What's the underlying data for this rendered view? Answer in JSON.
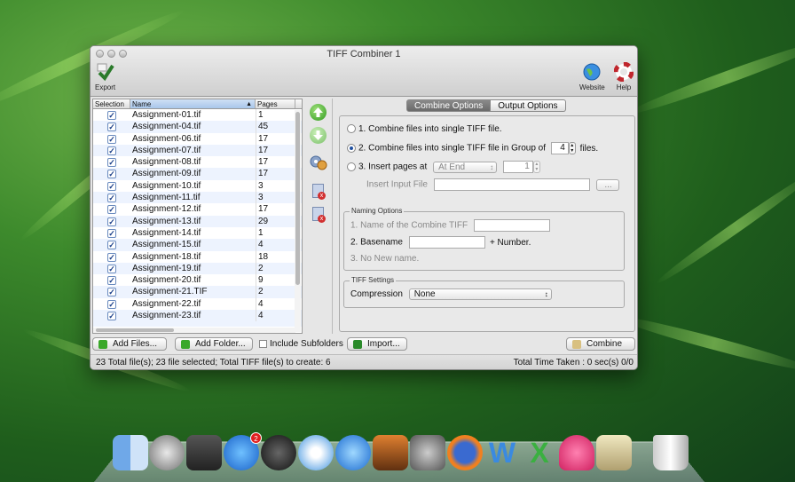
{
  "window": {
    "title": "TIFF Combiner 1"
  },
  "toolbar": {
    "export": "Export",
    "website": "Website",
    "help": "Help"
  },
  "list": {
    "headers": [
      "Selection",
      "Name",
      "Pages"
    ],
    "rows": [
      {
        "name": "Assignment-01.tif",
        "pages": "1"
      },
      {
        "name": "Assignment-04.tif",
        "pages": "45"
      },
      {
        "name": "Assignment-06.tif",
        "pages": "17"
      },
      {
        "name": "Assignment-07.tif",
        "pages": "17"
      },
      {
        "name": "Assignment-08.tif",
        "pages": "17"
      },
      {
        "name": "Assignment-09.tif",
        "pages": "17"
      },
      {
        "name": "Assignment-10.tif",
        "pages": "3"
      },
      {
        "name": "Assignment-11.tif",
        "pages": "3"
      },
      {
        "name": "Assignment-12.tif",
        "pages": "17"
      },
      {
        "name": "Assignment-13.tif",
        "pages": "29"
      },
      {
        "name": "Assignment-14.tif",
        "pages": "1"
      },
      {
        "name": "Assignment-15.tif",
        "pages": "4"
      },
      {
        "name": "Assignment-18.tif",
        "pages": "18"
      },
      {
        "name": "Assignment-19.tif",
        "pages": "2"
      },
      {
        "name": "Assignment-20.tif",
        "pages": "9"
      },
      {
        "name": "Assignment-21.TIF",
        "pages": "2"
      },
      {
        "name": "Assignment-22.tif",
        "pages": "4"
      },
      {
        "name": "Assignment-23.tif",
        "pages": "4"
      }
    ]
  },
  "tabs": {
    "combine": "Combine Options",
    "output": "Output Options"
  },
  "options": {
    "opt1": "1. Combine files into single TIFF file.",
    "opt2": "2. Combine files into single TIFF file in Group of",
    "group_value": "4",
    "files": "files.",
    "opt3": "3. Insert pages at",
    "at_value": "At End",
    "page_value": "1",
    "insert_input": "Insert Input File",
    "browse": "..."
  },
  "naming": {
    "legend": "Naming Options",
    "n1": "1. Name of the Combine TIFF",
    "n2": "2. Basename",
    "plus": "+ Number.",
    "n3": "3. No New name."
  },
  "tiff": {
    "legend": "TIFF Settings",
    "compression_label": "Compression",
    "compression_value": "None"
  },
  "buttons": {
    "add_files": "Add Files...",
    "add_folder": "Add Folder...",
    "include_sub": "Include Subfolders",
    "import": "Import...",
    "combine": "Combine"
  },
  "status": {
    "left": "23 Total file(s); 23 file selected; Total TIFF file(s) to create: 6",
    "right": "Total Time Taken : 0 sec(s) 0/0"
  },
  "dock": {
    "appstore_badge": "2"
  }
}
